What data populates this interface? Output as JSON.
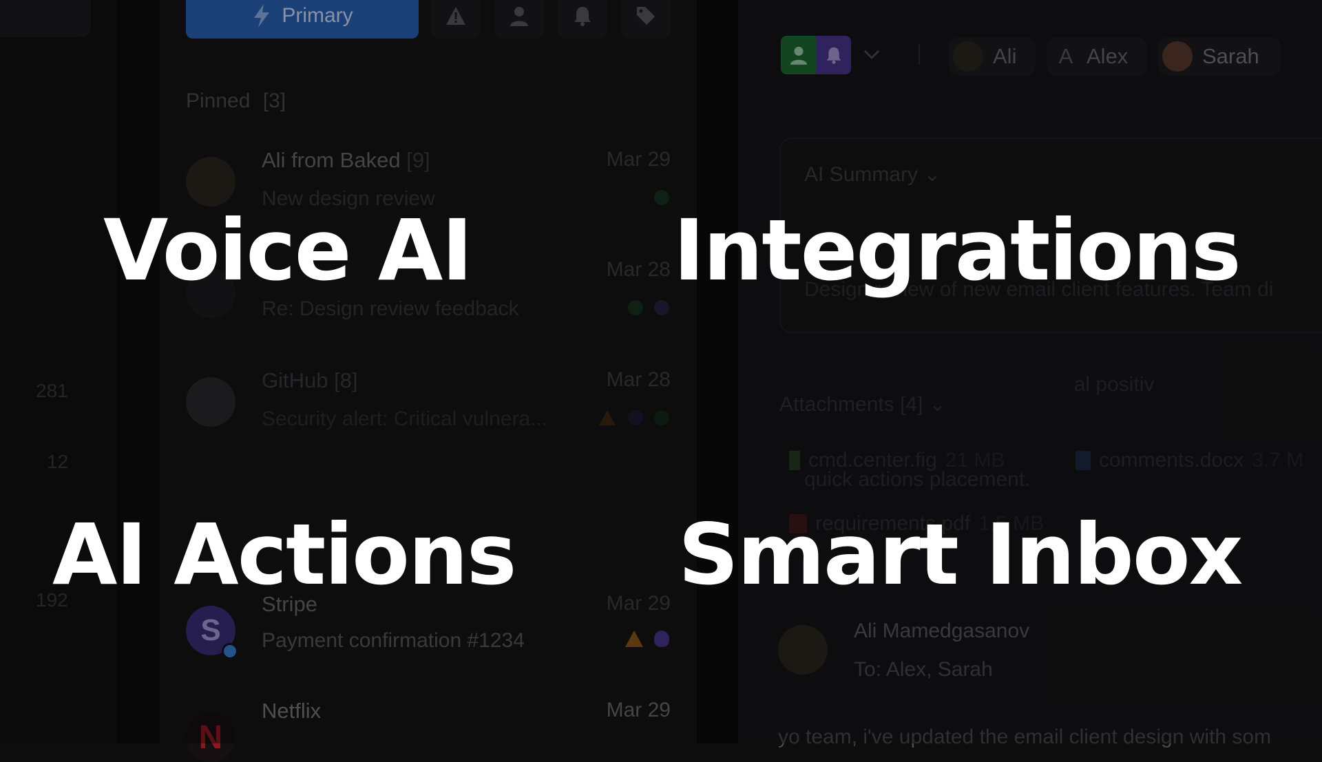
{
  "headlines": {
    "top_left": "Voice AI",
    "top_right": "Integrations",
    "bottom_left": "AI Actions",
    "bottom_right": "Smart Inbox"
  },
  "toolbar": {
    "primary_label": "Primary"
  },
  "pinned": {
    "label": "Pinned",
    "count": "[3]"
  },
  "sidebar_counts": [
    "281",
    "12",
    "192"
  ],
  "list": [
    {
      "sender": "Ali from Baked",
      "count": "[9]",
      "date": "Mar 29",
      "subject": "New design review"
    },
    {
      "sender": "",
      "count": "",
      "date": "Mar 28",
      "subject": "Re: Design review feedback"
    },
    {
      "sender": "GitHub",
      "count": "[8]",
      "date": "Mar 28",
      "subject": "Security alert: Critical vulnera..."
    },
    {
      "sender": "Stripe",
      "count": "",
      "date": "Mar 29",
      "subject": "Payment confirmation #1234"
    },
    {
      "sender": "Netflix",
      "count": "",
      "date": "Mar 29",
      "subject": ""
    }
  ],
  "detail": {
    "people": [
      "Ali",
      "Alex",
      "Sarah"
    ],
    "alex_initial": "A",
    "summary_label": "AI Summary",
    "summary_lines": [
      "Design review of new email client features. Team di",
      "                                               al positiv",
      "quick actions placement."
    ],
    "attachments_label": "Attachments",
    "attachments_count": "[4]",
    "files": [
      {
        "name": "cmd.center.fig",
        "size": "21 MB"
      },
      {
        "name": "comments.docx",
        "size": "3.7 M"
      },
      {
        "name": "requirements.pdf",
        "size": "1.5 MB"
      }
    ],
    "from_name": "Ali Mamedgasanov",
    "to_label": "To:",
    "to_names": "Alex, Sarah",
    "body_start": "yo team, i've updated the email client design with som"
  },
  "colors": {
    "primary": "#2a63b8",
    "green": "#1f7a3a",
    "purple": "#5b3fa8",
    "warning": "#b9791c"
  }
}
